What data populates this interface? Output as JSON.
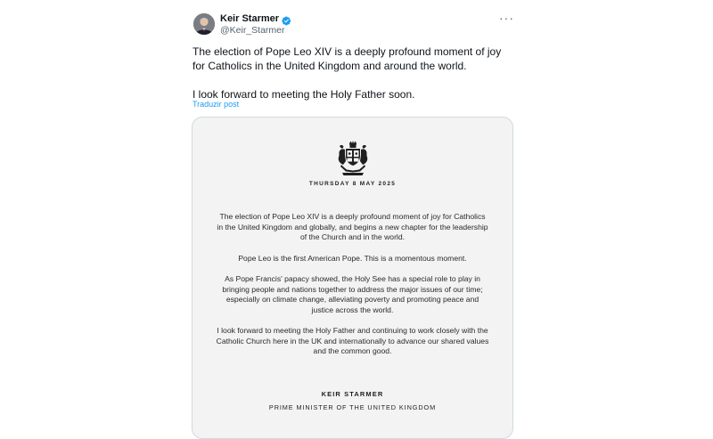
{
  "author": {
    "display_name": "Keir Starmer",
    "handle": "@Keir_Starmer",
    "verified_icon": "verified-badge-icon",
    "avatar_icon": "profile-photo"
  },
  "tweet": {
    "paragraphs": [
      "The election of Pope Leo XIV is a deeply profound moment of joy for Catholics in the United Kingdom and around the world.",
      "I look forward to meeting the Holy Father soon."
    ],
    "translate_label": "Traduzir post"
  },
  "statement": {
    "crest_icon": "royal-coat-of-arms",
    "date": "THURSDAY 8 MAY 2025",
    "paragraphs": [
      "The election of Pope Leo XIV is a deeply profound moment of joy for Catholics in the United Kingdom and globally, and begins a new chapter for the leadership of the Church and in the world.",
      "Pope Leo is the first American Pope. This is a momentous moment.",
      "As Pope Francis' papacy showed, the Holy See has a special role to play in bringing people and nations together to address the major issues of our time; especially on climate change, alleviating poverty and promoting peace and justice across the world.",
      "I look forward to meeting the Holy Father and continuing to work closely with the Catholic Church here in the UK and internationally to advance our shared values and the common good."
    ],
    "signature": "KEIR STARMER",
    "title": "PRIME MINISTER OF THE UNITED KINGDOM"
  },
  "colors": {
    "link": "#1d9bf0",
    "verified": "#1d9bf0",
    "muted": "#536471",
    "card_background": "#f3f3f3"
  }
}
